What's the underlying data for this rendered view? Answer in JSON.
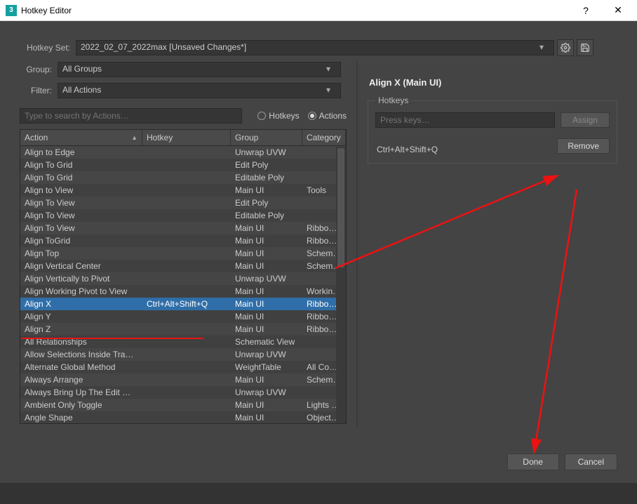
{
  "window": {
    "title": "Hotkey Editor",
    "app_icon_text": "3"
  },
  "hotkeySet": {
    "label": "Hotkey Set:",
    "value": "2022_02_07_2022max [Unsaved Changes*]"
  },
  "group": {
    "label": "Group:",
    "value": "All Groups"
  },
  "filter": {
    "label": "Filter:",
    "value": "All Actions"
  },
  "search": {
    "placeholder": "Type to search by Actions…"
  },
  "radios": {
    "hotkeys": "Hotkeys",
    "actions": "Actions",
    "selected": "actions"
  },
  "columns": {
    "action": "Action",
    "hotkey": "Hotkey",
    "group": "Group",
    "category": "Category"
  },
  "rows": [
    {
      "action": "Align to Edge",
      "hotkey": "",
      "group": "Unwrap UVW",
      "category": ""
    },
    {
      "action": "Align To Grid",
      "hotkey": "",
      "group": "Edit Poly",
      "category": ""
    },
    {
      "action": "Align To Grid",
      "hotkey": "",
      "group": "Editable Poly",
      "category": ""
    },
    {
      "action": "Align to View",
      "hotkey": "",
      "group": "Main UI",
      "category": "Tools"
    },
    {
      "action": "Align To View",
      "hotkey": "",
      "group": "Edit Poly",
      "category": ""
    },
    {
      "action": "Align To View",
      "hotkey": "",
      "group": "Editable Poly",
      "category": ""
    },
    {
      "action": "Align To View",
      "hotkey": "",
      "group": "Main UI",
      "category": "Ribbon - M"
    },
    {
      "action": "Align ToGrid",
      "hotkey": "",
      "group": "Main UI",
      "category": "Ribbon - M"
    },
    {
      "action": "Align Top",
      "hotkey": "",
      "group": "Main UI",
      "category": "Schematic"
    },
    {
      "action": "Align Vertical Center",
      "hotkey": "",
      "group": "Main UI",
      "category": "Schematic"
    },
    {
      "action": "Align Vertically to Pivot",
      "hotkey": "",
      "group": "Unwrap UVW",
      "category": ""
    },
    {
      "action": "Align Working Pivot to View",
      "hotkey": "",
      "group": "Main UI",
      "category": "Working P"
    },
    {
      "action": "Align X",
      "hotkey": "Ctrl+Alt+Shift+Q",
      "group": "Main UI",
      "category": "Ribbon - M",
      "selected": true
    },
    {
      "action": "Align Y",
      "hotkey": "",
      "group": "Main UI",
      "category": "Ribbon - M"
    },
    {
      "action": "Align Z",
      "hotkey": "",
      "group": "Main UI",
      "category": "Ribbon - M"
    },
    {
      "action": "All Relationships",
      "hotkey": "",
      "group": "Schematic View",
      "category": ""
    },
    {
      "action": "Allow Selections Inside Tranform …",
      "hotkey": "",
      "group": "Unwrap UVW",
      "category": ""
    },
    {
      "action": "Alternate Global Method",
      "hotkey": "",
      "group": "WeightTable",
      "category": "All Comma"
    },
    {
      "action": "Always Arrange",
      "hotkey": "",
      "group": "Main UI",
      "category": "Schematic"
    },
    {
      "action": "Always Bring Up The Edit Window",
      "hotkey": "",
      "group": "Unwrap UVW",
      "category": ""
    },
    {
      "action": "Ambient Only Toggle",
      "hotkey": "",
      "group": "Main UI",
      "category": "Lights and"
    },
    {
      "action": "Angle Shape",
      "hotkey": "",
      "group": "Main UI",
      "category": "Objects Sh"
    }
  ],
  "detail": {
    "title": "Align X (Main UI)",
    "group_label": "Hotkeys",
    "input_placeholder": "Press keys…",
    "assign_label": "Assign",
    "hotkey_text": "Ctrl+Alt+Shift+Q",
    "remove_label": "Remove"
  },
  "footer": {
    "done": "Done",
    "cancel": "Cancel"
  }
}
